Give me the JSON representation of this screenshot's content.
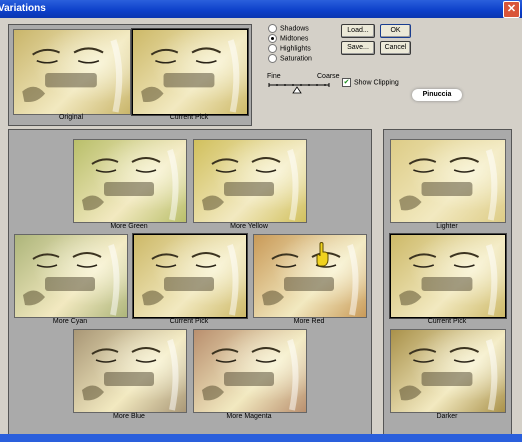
{
  "window": {
    "title": "Variations",
    "close_label": "✕"
  },
  "top": {
    "original_label": "Original",
    "current_pick_label": "Current Pick"
  },
  "options": {
    "radios": [
      {
        "label": "Shadows",
        "selected": false
      },
      {
        "label": "Midtones",
        "selected": true
      },
      {
        "label": "Highlights",
        "selected": false
      },
      {
        "label": "Saturation",
        "selected": false
      }
    ],
    "fine_label": "Fine",
    "coarse_label": "Coarse",
    "show_clipping_label": "Show Clipping",
    "show_clipping_checked": true
  },
  "buttons": {
    "load": "Load...",
    "ok": "OK",
    "save": "Save...",
    "cancel": "Cancel"
  },
  "badge": "Pinuccia",
  "grid": {
    "more_green": "More Green",
    "more_yellow": "More Yellow",
    "more_cyan": "More Cyan",
    "current_pick": "Current Pick",
    "more_red": "More Red",
    "more_blue": "More Blue",
    "more_magenta": "More Magenta"
  },
  "brightness": {
    "lighter": "Lighter",
    "current_pick": "Current Pick",
    "darker": "Darker"
  },
  "colors": {
    "original": "#c9b56a",
    "current": "#cdb968",
    "green": "#b9bf6a",
    "yellow": "#d1c05d",
    "cyan": "#adb57a",
    "red": "#c99a58",
    "blue": "#a99776",
    "magenta": "#b98f6e",
    "lighter": "#ddcc86",
    "darker": "#a9914a"
  }
}
